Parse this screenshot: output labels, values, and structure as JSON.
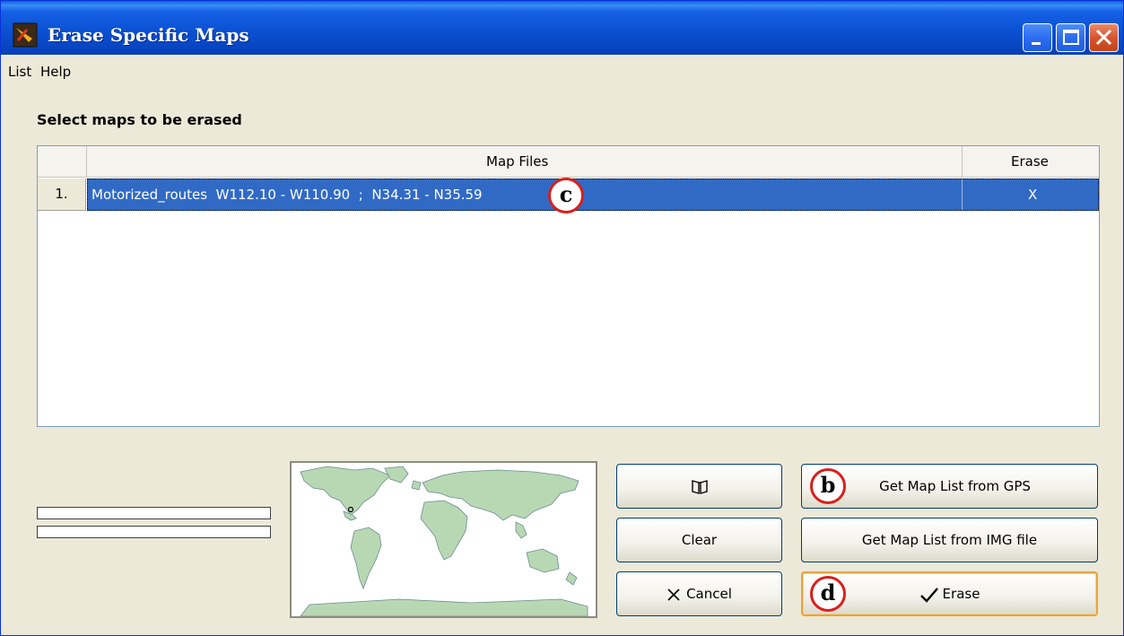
{
  "window": {
    "title": "Erase Specific Maps"
  },
  "menu": {
    "items": [
      "List",
      "Help"
    ]
  },
  "main": {
    "section_label": "Select maps to be erased",
    "grid": {
      "columns": [
        "Map Files",
        "Erase"
      ],
      "rows": [
        {
          "index": "1.",
          "map_file": "Motorized_routes  W112.10 - W110.90  ;  N34.31 - N35.59",
          "erase": "X",
          "selected": true
        }
      ]
    }
  },
  "buttons": {
    "book_icon": "book-icon",
    "clear": "Clear",
    "cancel": "Cancel",
    "get_from_gps": "Get Map List from GPS",
    "get_from_img": "Get Map List from IMG file",
    "erase": "Erase"
  },
  "callouts": {
    "c": "c",
    "b": "b",
    "d": "d"
  },
  "colors": {
    "selection": "#316ac5",
    "callout_border": "#d8201c",
    "titlebar": "#0a4fd0"
  }
}
